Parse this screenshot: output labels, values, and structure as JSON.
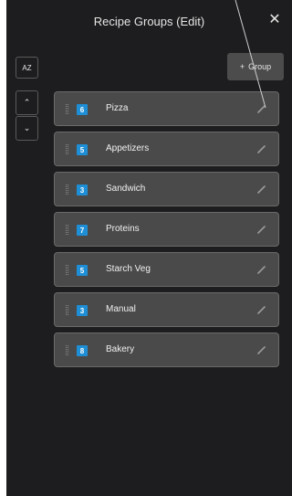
{
  "header": {
    "title": "Recipe Groups (Edit)",
    "close_symbol": "✕"
  },
  "toolbar": {
    "sort_label": "AZ",
    "up_symbol": "⌃",
    "down_symbol": "⌄",
    "add_plus": "+",
    "add_label": "Group"
  },
  "groups": [
    {
      "count": "6",
      "label": "Pizza"
    },
    {
      "count": "5",
      "label": "Appetizers"
    },
    {
      "count": "3",
      "label": "Sandwich"
    },
    {
      "count": "7",
      "label": "Proteins"
    },
    {
      "count": "5",
      "label": "Starch Veg"
    },
    {
      "count": "3",
      "label": "Manual"
    },
    {
      "count": "8",
      "label": "Bakery"
    }
  ],
  "colors": {
    "panel_bg": "#1d1d1f",
    "row_bg": "#4a4a4a",
    "badge": "#1e8fd6",
    "button_bg": "#4c4c4c"
  },
  "icons": [
    "close-icon",
    "sort-az-icon",
    "chevron-up-icon",
    "chevron-down-icon",
    "drag-handle-icon",
    "pencil-icon"
  ]
}
